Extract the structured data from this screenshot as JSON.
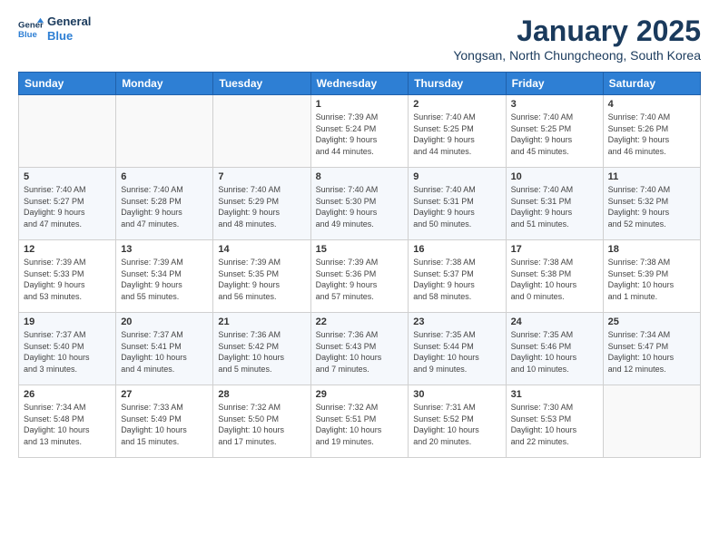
{
  "header": {
    "logo_line1": "General",
    "logo_line2": "Blue",
    "title": "January 2025",
    "subtitle": "Yongsan, North Chungcheong, South Korea"
  },
  "weekdays": [
    "Sunday",
    "Monday",
    "Tuesday",
    "Wednesday",
    "Thursday",
    "Friday",
    "Saturday"
  ],
  "weeks": [
    [
      {
        "day": "",
        "info": ""
      },
      {
        "day": "",
        "info": ""
      },
      {
        "day": "",
        "info": ""
      },
      {
        "day": "1",
        "info": "Sunrise: 7:39 AM\nSunset: 5:24 PM\nDaylight: 9 hours\nand 44 minutes."
      },
      {
        "day": "2",
        "info": "Sunrise: 7:40 AM\nSunset: 5:25 PM\nDaylight: 9 hours\nand 44 minutes."
      },
      {
        "day": "3",
        "info": "Sunrise: 7:40 AM\nSunset: 5:25 PM\nDaylight: 9 hours\nand 45 minutes."
      },
      {
        "day": "4",
        "info": "Sunrise: 7:40 AM\nSunset: 5:26 PM\nDaylight: 9 hours\nand 46 minutes."
      }
    ],
    [
      {
        "day": "5",
        "info": "Sunrise: 7:40 AM\nSunset: 5:27 PM\nDaylight: 9 hours\nand 47 minutes."
      },
      {
        "day": "6",
        "info": "Sunrise: 7:40 AM\nSunset: 5:28 PM\nDaylight: 9 hours\nand 47 minutes."
      },
      {
        "day": "7",
        "info": "Sunrise: 7:40 AM\nSunset: 5:29 PM\nDaylight: 9 hours\nand 48 minutes."
      },
      {
        "day": "8",
        "info": "Sunrise: 7:40 AM\nSunset: 5:30 PM\nDaylight: 9 hours\nand 49 minutes."
      },
      {
        "day": "9",
        "info": "Sunrise: 7:40 AM\nSunset: 5:31 PM\nDaylight: 9 hours\nand 50 minutes."
      },
      {
        "day": "10",
        "info": "Sunrise: 7:40 AM\nSunset: 5:31 PM\nDaylight: 9 hours\nand 51 minutes."
      },
      {
        "day": "11",
        "info": "Sunrise: 7:40 AM\nSunset: 5:32 PM\nDaylight: 9 hours\nand 52 minutes."
      }
    ],
    [
      {
        "day": "12",
        "info": "Sunrise: 7:39 AM\nSunset: 5:33 PM\nDaylight: 9 hours\nand 53 minutes."
      },
      {
        "day": "13",
        "info": "Sunrise: 7:39 AM\nSunset: 5:34 PM\nDaylight: 9 hours\nand 55 minutes."
      },
      {
        "day": "14",
        "info": "Sunrise: 7:39 AM\nSunset: 5:35 PM\nDaylight: 9 hours\nand 56 minutes."
      },
      {
        "day": "15",
        "info": "Sunrise: 7:39 AM\nSunset: 5:36 PM\nDaylight: 9 hours\nand 57 minutes."
      },
      {
        "day": "16",
        "info": "Sunrise: 7:38 AM\nSunset: 5:37 PM\nDaylight: 9 hours\nand 58 minutes."
      },
      {
        "day": "17",
        "info": "Sunrise: 7:38 AM\nSunset: 5:38 PM\nDaylight: 10 hours\nand 0 minutes."
      },
      {
        "day": "18",
        "info": "Sunrise: 7:38 AM\nSunset: 5:39 PM\nDaylight: 10 hours\nand 1 minute."
      }
    ],
    [
      {
        "day": "19",
        "info": "Sunrise: 7:37 AM\nSunset: 5:40 PM\nDaylight: 10 hours\nand 3 minutes."
      },
      {
        "day": "20",
        "info": "Sunrise: 7:37 AM\nSunset: 5:41 PM\nDaylight: 10 hours\nand 4 minutes."
      },
      {
        "day": "21",
        "info": "Sunrise: 7:36 AM\nSunset: 5:42 PM\nDaylight: 10 hours\nand 5 minutes."
      },
      {
        "day": "22",
        "info": "Sunrise: 7:36 AM\nSunset: 5:43 PM\nDaylight: 10 hours\nand 7 minutes."
      },
      {
        "day": "23",
        "info": "Sunrise: 7:35 AM\nSunset: 5:44 PM\nDaylight: 10 hours\nand 9 minutes."
      },
      {
        "day": "24",
        "info": "Sunrise: 7:35 AM\nSunset: 5:46 PM\nDaylight: 10 hours\nand 10 minutes."
      },
      {
        "day": "25",
        "info": "Sunrise: 7:34 AM\nSunset: 5:47 PM\nDaylight: 10 hours\nand 12 minutes."
      }
    ],
    [
      {
        "day": "26",
        "info": "Sunrise: 7:34 AM\nSunset: 5:48 PM\nDaylight: 10 hours\nand 13 minutes."
      },
      {
        "day": "27",
        "info": "Sunrise: 7:33 AM\nSunset: 5:49 PM\nDaylight: 10 hours\nand 15 minutes."
      },
      {
        "day": "28",
        "info": "Sunrise: 7:32 AM\nSunset: 5:50 PM\nDaylight: 10 hours\nand 17 minutes."
      },
      {
        "day": "29",
        "info": "Sunrise: 7:32 AM\nSunset: 5:51 PM\nDaylight: 10 hours\nand 19 minutes."
      },
      {
        "day": "30",
        "info": "Sunrise: 7:31 AM\nSunset: 5:52 PM\nDaylight: 10 hours\nand 20 minutes."
      },
      {
        "day": "31",
        "info": "Sunrise: 7:30 AM\nSunset: 5:53 PM\nDaylight: 10 hours\nand 22 minutes."
      },
      {
        "day": "",
        "info": ""
      }
    ]
  ]
}
